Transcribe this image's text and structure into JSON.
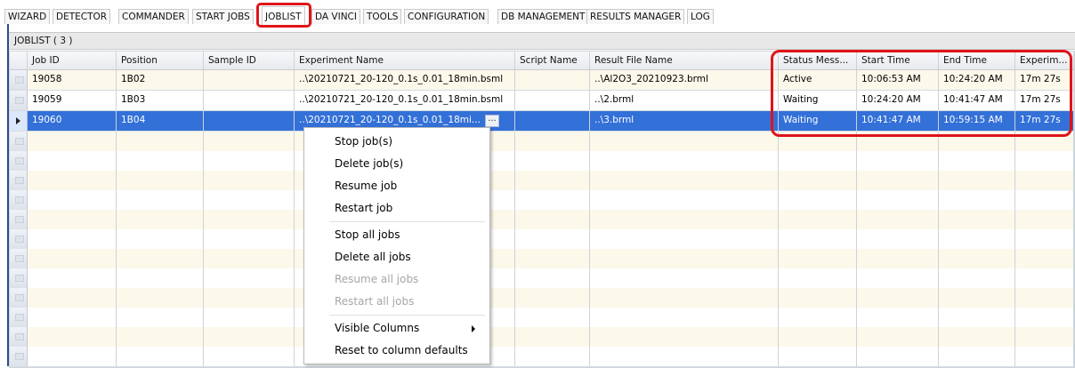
{
  "tabs": [
    "WIZARD",
    "DETECTOR",
    "COMMANDER",
    "START JOBS",
    "JOBLIST",
    "DA VINCI",
    "TOOLS",
    "CONFIGURATION",
    "DB MANAGEMENT",
    "RESULTS MANAGER",
    "LOG"
  ],
  "active_tab": "JOBLIST",
  "panel_title": "JOBLIST ( 3 )",
  "columns": [
    "Job ID",
    "Position",
    "Sample ID",
    "Experiment Name",
    "Script Name",
    "Result File Name",
    "Status Mess...",
    "Start Time",
    "End Time",
    "Experim..."
  ],
  "rows": [
    {
      "job_id": "19058",
      "position": "1B02",
      "sample_id": "",
      "experiment_name": "..\\20210721_20-120_0.1s_0.01_18min.bsml",
      "script_name": "",
      "result_file_name": "..\\Al2O3_20210923.brml",
      "status": "Active",
      "start_time": "10:06:53 AM",
      "end_time": "10:24:20 AM",
      "experiment_time": "17m 27s"
    },
    {
      "job_id": "19059",
      "position": "1B03",
      "sample_id": "",
      "experiment_name": "..\\20210721_20-120_0.1s_0.01_18min.bsml",
      "script_name": "",
      "result_file_name": "..\\2.brml",
      "status": "Waiting",
      "start_time": "10:24:20 AM",
      "end_time": "10:41:47 AM",
      "experiment_time": "17m 27s"
    },
    {
      "job_id": "19060",
      "position": "1B04",
      "sample_id": "",
      "experiment_name": "..\\20210721_20-120_0.1s_0.01_18mi...",
      "script_name": "",
      "result_file_name": "..\\3.brml",
      "status": "Waiting",
      "start_time": "10:41:47 AM",
      "end_time": "10:59:15 AM",
      "experiment_time": "17m 27s"
    }
  ],
  "context_menu": {
    "items": [
      {
        "label": "Stop job(s)",
        "disabled": false
      },
      {
        "label": "Delete job(s)",
        "disabled": false
      },
      {
        "label": "Resume job",
        "disabled": false
      },
      {
        "label": "Restart job",
        "disabled": false
      },
      {
        "label": "Stop all jobs",
        "disabled": false
      },
      {
        "label": "Delete all jobs",
        "disabled": false
      },
      {
        "label": "Resume all jobs",
        "disabled": true
      },
      {
        "label": "Restart all jobs",
        "disabled": true
      },
      {
        "label": "Visible Columns",
        "disabled": false,
        "submenu": true
      },
      {
        "label": "Reset to column defaults",
        "disabled": false
      }
    ]
  },
  "ellipsis_label": "...",
  "colors": {
    "selected_row": "#3370d8",
    "highlight": "#e0131a",
    "alt_row": "#fcf8ea"
  }
}
